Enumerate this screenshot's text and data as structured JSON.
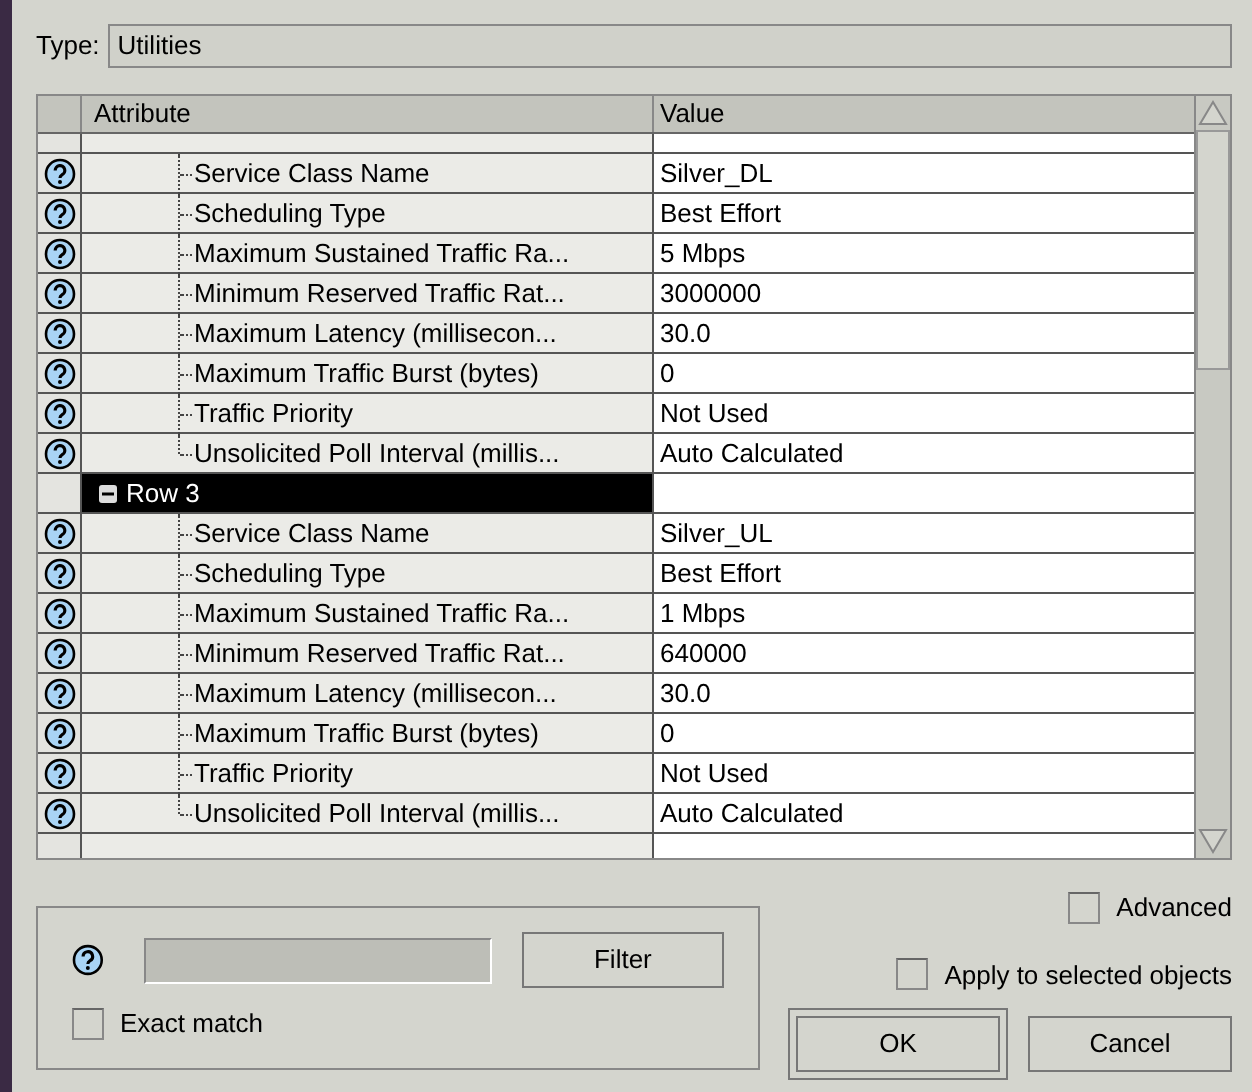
{
  "type_field": {
    "label": "Type:",
    "value": "Utilities"
  },
  "table": {
    "columns": [
      "Attribute",
      "Value"
    ],
    "groups": [
      {
        "children": [
          {
            "name": "Service Class Name",
            "value": "Silver_DL"
          },
          {
            "name": "Scheduling Type",
            "value": "Best Effort"
          },
          {
            "name": "Maximum Sustained Traffic Ra...",
            "value": "5 Mbps"
          },
          {
            "name": "Minimum Reserved Traffic Rat...",
            "value": "3000000"
          },
          {
            "name": "Maximum Latency (millisecon...",
            "value": "30.0"
          },
          {
            "name": "Maximum Traffic Burst (bytes)",
            "value": "0"
          },
          {
            "name": "Traffic Priority",
            "value": "Not Used"
          },
          {
            "name": "Unsolicited Poll Interval (millis...",
            "value": "Auto Calculated"
          }
        ]
      },
      {
        "label": "Row 3",
        "expanded": true,
        "selected": true,
        "children": [
          {
            "name": "Service Class Name",
            "value": "Silver_UL"
          },
          {
            "name": "Scheduling Type",
            "value": "Best Effort"
          },
          {
            "name": "Maximum Sustained Traffic Ra...",
            "value": "1 Mbps"
          },
          {
            "name": "Minimum Reserved Traffic Rat...",
            "value": "640000"
          },
          {
            "name": "Maximum Latency (millisecon...",
            "value": "30.0"
          },
          {
            "name": "Maximum Traffic Burst (bytes)",
            "value": "0"
          },
          {
            "name": "Traffic Priority",
            "value": "Not Used"
          },
          {
            "name": "Unsolicited Poll Interval (millis...",
            "value": "Auto Calculated"
          }
        ]
      }
    ]
  },
  "filter": {
    "button": "Filter",
    "exact_match": {
      "label": "Exact match",
      "checked": false
    }
  },
  "advanced": {
    "label": "Advanced",
    "checked": false
  },
  "apply_selected": {
    "label": "Apply to selected objects",
    "checked": false
  },
  "buttons": [
    "OK",
    "Cancel"
  ]
}
